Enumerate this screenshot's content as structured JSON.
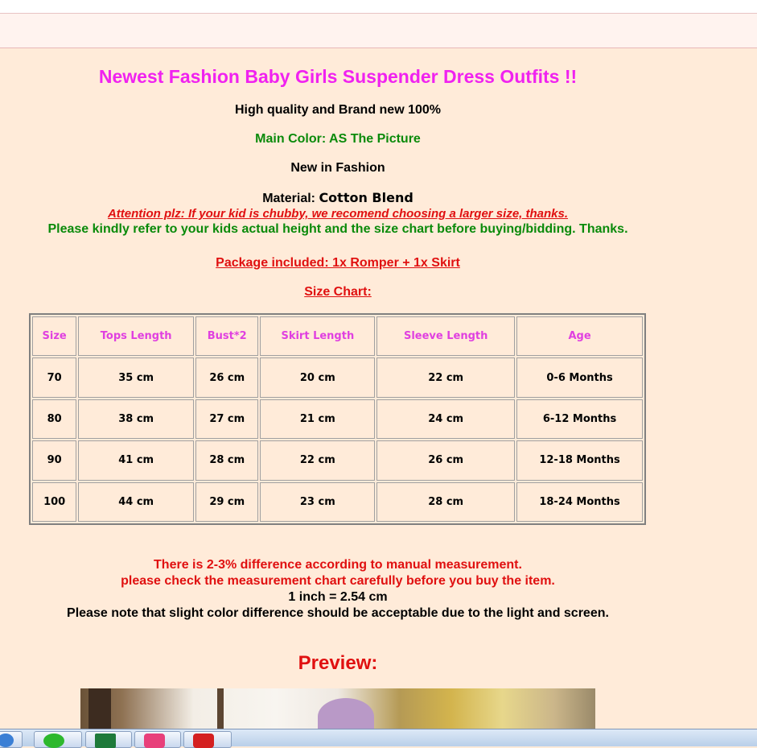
{
  "product": {
    "title": "Newest Fashion Baby Girls Suspender Dress Outfits !!",
    "quality": "High quality and Brand new 100%",
    "main_color": "Main Color:  AS The Picture",
    "fashion": "New in Fashion",
    "material_label": "Material: ",
    "material_value": "Cotton Blend",
    "attention": "Attention plz: If your kid is chubby, we recomend choosing a larger size, thanks.",
    "refer": "Please kindly refer to your kids actual height and the size chart before buying/bidding. Thanks.",
    "package": "Package included: 1x Romper + 1x Skirt",
    "size_chart_title": "Size Chart:"
  },
  "size_chart": {
    "headers": [
      "Size",
      "Tops Length",
      "Bust*2",
      "Skirt Length",
      "Sleeve Length",
      "Age"
    ],
    "rows": [
      [
        "70",
        "35 cm",
        "26 cm",
        "20 cm",
        "22 cm",
        "0-6 Months"
      ],
      [
        "80",
        "38 cm",
        "27 cm",
        "21 cm",
        "24 cm",
        "6-12 Months"
      ],
      [
        "90",
        "41 cm",
        "28 cm",
        "22 cm",
        "26 cm",
        "12-18 Months"
      ],
      [
        "100",
        "44 cm",
        "29 cm",
        "23 cm",
        "28 cm",
        "18-24 Months"
      ]
    ]
  },
  "notes": {
    "difference": "There is 2-3% difference according to manual measurement.",
    "check": "please check the measurement chart carefully before you buy the item.",
    "inch": "1 inch = 2.54 cm",
    "color_note": "Please note that slight color difference should be acceptable due to the light and screen."
  },
  "preview_label": "Preview:",
  "taskbar": {
    "items": [
      {
        "icon": "ie-icon",
        "color": "#3a7fd5"
      },
      {
        "icon": "wechat-icon",
        "color": "#2db82d"
      },
      {
        "icon": "excel-icon",
        "color": "#1e7a3a"
      },
      {
        "icon": "app-pink-icon",
        "color": "#e8407a"
      },
      {
        "icon": "netease-music-icon",
        "color": "#d42020"
      }
    ]
  },
  "colors": {
    "background": "#ffebd9",
    "title": "#f022f0",
    "green": "#0a8a0a",
    "red": "#e01010"
  }
}
